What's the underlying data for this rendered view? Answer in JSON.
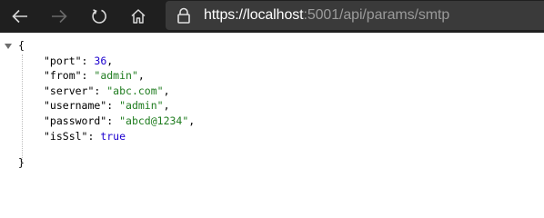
{
  "browser": {
    "url_scheme": "https://",
    "url_host": "localhost",
    "url_rest": ":5001/api/params/smtp"
  },
  "json_view": {
    "open_brace": "{",
    "close_brace": "}",
    "entries": [
      {
        "key": "\"port\"",
        "value": "36",
        "sep": ","
      },
      {
        "key": "\"from\"",
        "value": "\"admin\"",
        "sep": ","
      },
      {
        "key": "\"server\"",
        "value": "\"abc.com\"",
        "sep": ","
      },
      {
        "key": "\"username\"",
        "value": "\"admin\"",
        "sep": ","
      },
      {
        "key": "\"password\"",
        "value": "\"abcd@1234\"",
        "sep": ","
      },
      {
        "key": "\"isSsl\"",
        "value": "true",
        "sep": ""
      }
    ]
  }
}
